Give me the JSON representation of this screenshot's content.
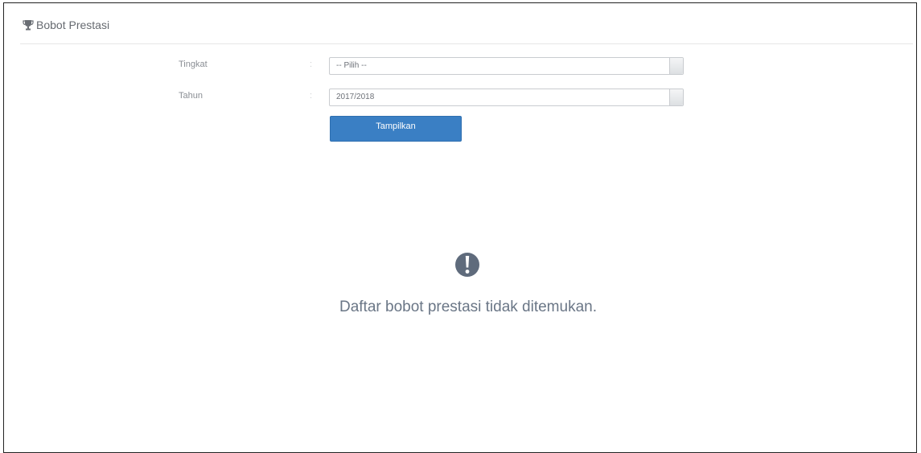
{
  "panel": {
    "title": "Bobot Prestasi",
    "icon": "trophy-icon"
  },
  "form": {
    "tingkat": {
      "label": "Tingkat",
      "separator": ":",
      "value": "-- Pilih --"
    },
    "tahun": {
      "label": "Tahun",
      "separator": ":",
      "value": "2017/2018"
    },
    "submit_label": "Tampilkan"
  },
  "empty_state": {
    "icon": "exclamation-circle-icon",
    "message": "Daftar bobot prestasi tidak ditemukan."
  },
  "colors": {
    "primary_button": "#3a7fc4",
    "empty_icon": "#5f6b7c",
    "empty_text": "#6a7686"
  }
}
